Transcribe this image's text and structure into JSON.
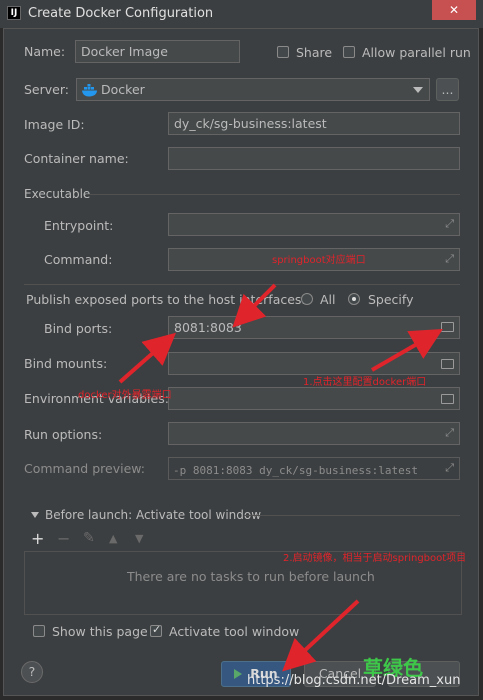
{
  "window": {
    "title": "Create Docker Configuration",
    "close_glyph": "✕"
  },
  "form": {
    "name_label": "Name:",
    "name_value": "Docker Image",
    "share_label": "Share",
    "parallel_label": "Allow parallel run",
    "server_label": "Server:",
    "server_value": "Docker",
    "server_more": "...",
    "image_id_label": "Image ID:",
    "image_id_value": "dy_ck/sg-business:latest",
    "container_label": "Container name:",
    "executable_section": "Executable",
    "entrypoint_label": "Entrypoint:",
    "command_label": "Command:",
    "publish_label": "Publish exposed ports to the host interfaces:",
    "publish_all": "All",
    "publish_specify": "Specify",
    "bind_ports_label": "Bind ports:",
    "bind_ports_value": "8081:8083",
    "bind_mounts_label": "Bind mounts:",
    "env_label": "Environment variables:",
    "run_options_label": "Run options:",
    "cmd_preview_label": "Command preview:",
    "cmd_preview_value": "-p 8081:8083 dy_ck/sg-business:latest"
  },
  "before_launch": {
    "title": "Before launch: Activate tool window",
    "toolbar": [
      "+",
      "−",
      "✎",
      "▲",
      "▼"
    ],
    "empty_text": "There are no tasks to run before launch"
  },
  "footer": {
    "show_page": "Show this page",
    "activate_window": "Activate tool window",
    "help": "?",
    "run": "Run",
    "cancel": "Cancel"
  },
  "annotations": {
    "springboot_port": "springboot对应端口",
    "docker_port": "docker对外暴露端口",
    "step1": "1.点击这里配置docker端口",
    "step2": "2.启动镜像，相当于启动springboot项目",
    "watermark_cn": "草绿色",
    "watermark_url": "https://blog.csdn.net/Dream_xun"
  },
  "colors": {
    "background": "#3c3f41",
    "field": "#45494a",
    "text": "#bbbbbb",
    "annotation_red": "#e0242b",
    "docker_blue": "#2396ed",
    "run_green": "#59a869",
    "watermark_green": "#3ec84a"
  }
}
